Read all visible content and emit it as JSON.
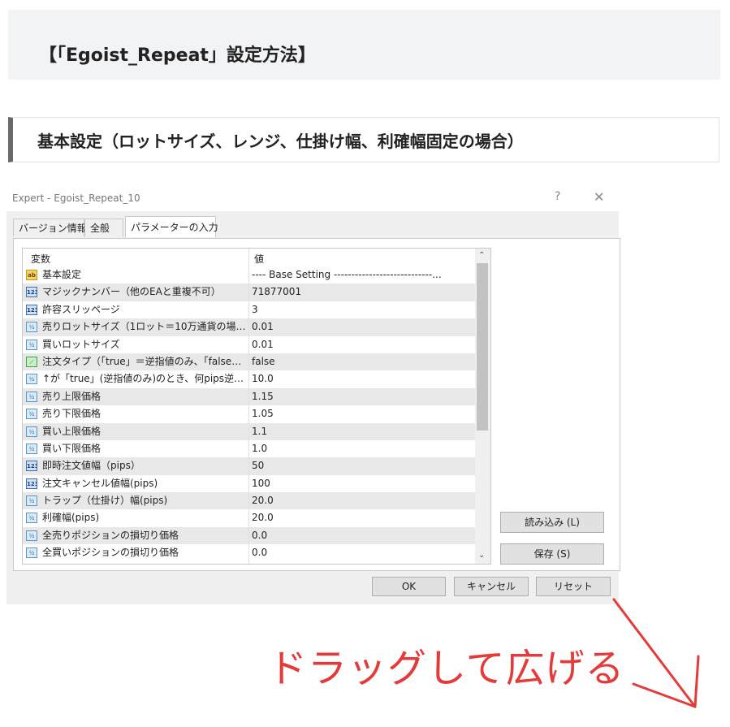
{
  "heading1": "【「Egoist_Repeat」設定方法】",
  "heading2": "基本設定（ロットサイズ、レンジ、仕掛け幅、利確幅固定の場合）",
  "dialog": {
    "title": "Expert - Egoist_Repeat_10",
    "help": "?",
    "close": "✕",
    "tabs": [
      {
        "label": "バージョン情報"
      },
      {
        "label": "全般"
      },
      {
        "label": "パラメーターの入力"
      }
    ],
    "table": {
      "col_name": "変数",
      "col_value": "値",
      "rows": [
        {
          "icon": "ab",
          "name": "基本設定",
          "value": "---- Base Setting ----------------------------..."
        },
        {
          "icon": "123",
          "name": "マジックナンバー（他のEAと重複不可）",
          "value": "71877001"
        },
        {
          "icon": "123",
          "name": "許容スリッページ",
          "value": "3"
        },
        {
          "icon": "½",
          "name": "売りロットサイズ（1ロット＝10万通貨の場合、0...",
          "value": "0.01"
        },
        {
          "icon": "½",
          "name": "買いロットサイズ",
          "value": "0.01"
        },
        {
          "icon": "⟋",
          "name": "注文タイプ（「true」＝逆指値のみ、「false」＝･..",
          "value": "false"
        },
        {
          "icon": "½",
          "name": "↑が「true」(逆指値のみ)のとき、何pips逆行し...",
          "value": "10.0"
        },
        {
          "icon": "½",
          "name": "売り上限価格",
          "value": "1.15"
        },
        {
          "icon": "½",
          "name": "売り下限価格",
          "value": "1.05"
        },
        {
          "icon": "½",
          "name": "買い上限価格",
          "value": "1.1"
        },
        {
          "icon": "½",
          "name": "買い下限価格",
          "value": "1.0"
        },
        {
          "icon": "123",
          "name": "即時注文値幅（pips）",
          "value": "50"
        },
        {
          "icon": "123",
          "name": "注文キャンセル値幅(pips)",
          "value": "100"
        },
        {
          "icon": "½",
          "name": "トラップ（仕掛け）幅(pips)",
          "value": "20.0"
        },
        {
          "icon": "½",
          "name": "利確幅(pips)",
          "value": "20.0"
        },
        {
          "icon": "½",
          "name": "全売りポジションの損切り価格",
          "value": "0.0"
        },
        {
          "icon": "½",
          "name": "全買いポジションの損切り価格",
          "value": "0.0"
        }
      ]
    },
    "buttons": {
      "load": "読み込み (L)",
      "save": "保存 (S)",
      "ok": "OK",
      "cancel": "キャンセル",
      "reset": "リセット"
    }
  },
  "annotation": "ドラッグして広げる",
  "colors": {
    "annotation": "#e53a3a",
    "heading_bg": "#f2f3f5"
  }
}
